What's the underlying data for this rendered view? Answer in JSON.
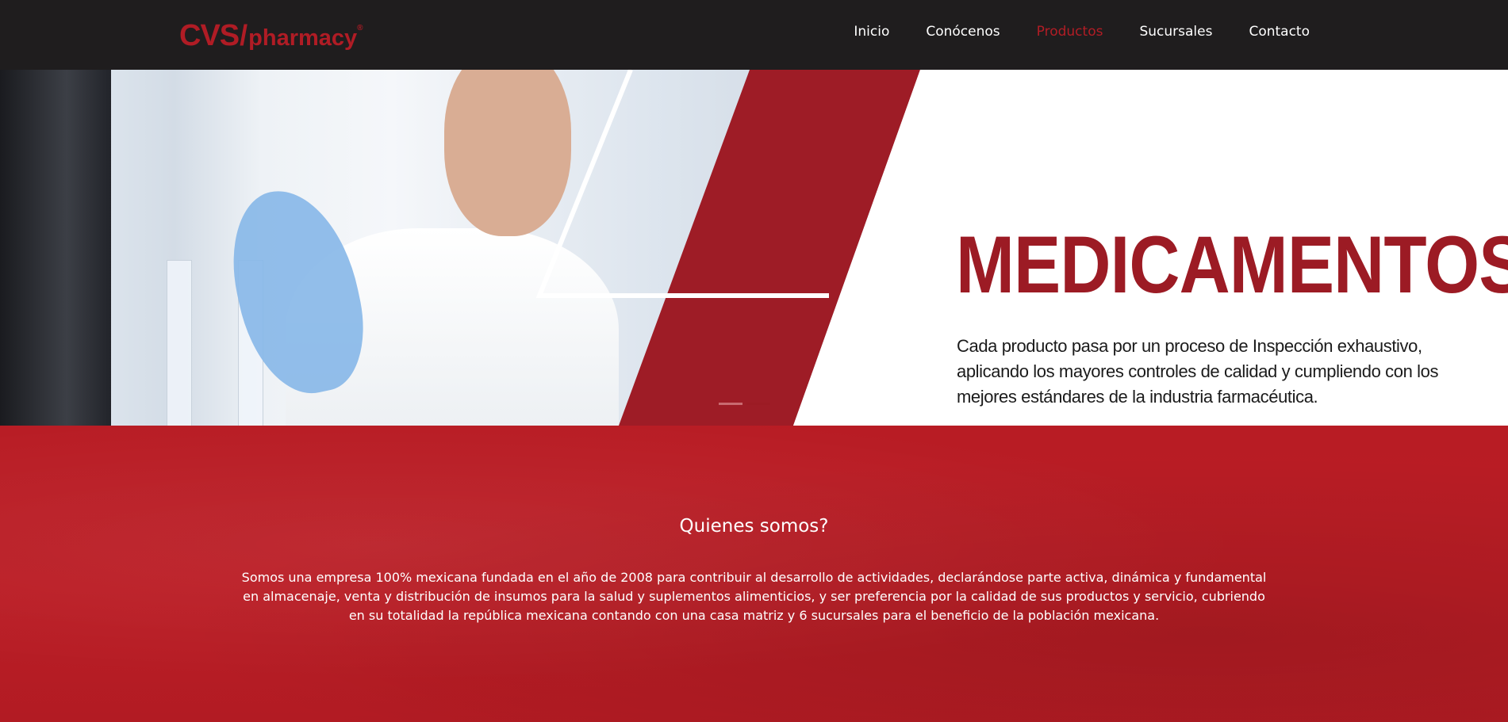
{
  "header": {
    "logo": {
      "brand": "CVS",
      "slash": "/",
      "sub": "pharmacy",
      "reg": "®"
    },
    "nav": [
      {
        "label": "Inicio",
        "active": false
      },
      {
        "label": "Conócenos",
        "active": false
      },
      {
        "label": "Productos",
        "active": true
      },
      {
        "label": "Sucursales",
        "active": false
      },
      {
        "label": "Contacto",
        "active": false
      }
    ]
  },
  "hero": {
    "headline": "MEDICAMENTOS",
    "text": "Cada producto pasa por un proceso de Inspección exhaustivo, aplicando los mayores controles de calidad y cumpliendo con los mejores estándares de la industria farmacéutica.",
    "slides": 2,
    "active_slide": 2
  },
  "about": {
    "title": "Quienes somos?",
    "text": "Somos una empresa 100% mexicana fundada en el año de 2008 para contribuir al desarrollo de actividades, declarándose parte activa, dinámica y fundamental en almacenaje, venta y distribución de insumos para la salud y suplementos alimenticios, y ser preferencia por la calidad de sus productos y servicio, cubriendo en su totalidad la república mexicana contando con una casa matriz y 6 sucursales para el beneficio de la población mexicana."
  },
  "colors": {
    "header_bg": "#1f1d1e",
    "brand_red": "#9c1b24",
    "section_red": "#b81c24",
    "nav_active": "#b21d25"
  }
}
